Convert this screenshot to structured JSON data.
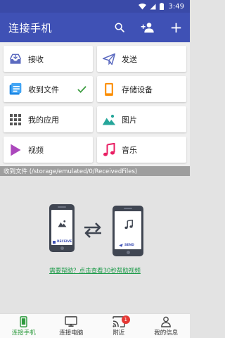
{
  "status_bar": {
    "time": "3:49"
  },
  "app_bar": {
    "title": "连接手机"
  },
  "tiles": [
    {
      "label": "接收",
      "icon": "inbox-receive-icon"
    },
    {
      "label": "发送",
      "icon": "send-plane-icon"
    },
    {
      "label": "收到文件",
      "icon": "received-files-icon",
      "checked": true
    },
    {
      "label": "存储设备",
      "icon": "storage-device-icon"
    },
    {
      "label": "我的应用",
      "icon": "apps-grid-icon"
    },
    {
      "label": "图片",
      "icon": "image-icon"
    },
    {
      "label": "视频",
      "icon": "video-play-icon"
    },
    {
      "label": "音乐",
      "icon": "music-note-icon"
    }
  ],
  "path_bar": {
    "text": "收到文件 (/storage/emulated/0/ReceivedFiles)"
  },
  "illustration": {
    "receive_label": "RECEIVE",
    "send_label": "SEND"
  },
  "help_link": "需要帮助？点击查看30秒帮助视频",
  "bottom_nav": [
    {
      "label": "连接手机",
      "active": true
    },
    {
      "label": "连接电脑",
      "active": false
    },
    {
      "label": "附近",
      "active": false,
      "badge": "1"
    },
    {
      "label": "我的信息",
      "active": false
    }
  ],
  "colors": {
    "primary": "#3f51b5",
    "status_bar": "#3a4aa8",
    "active_green": "#2e9b3e",
    "badge_red": "#e53935",
    "help_link": "#1e9b4a"
  }
}
